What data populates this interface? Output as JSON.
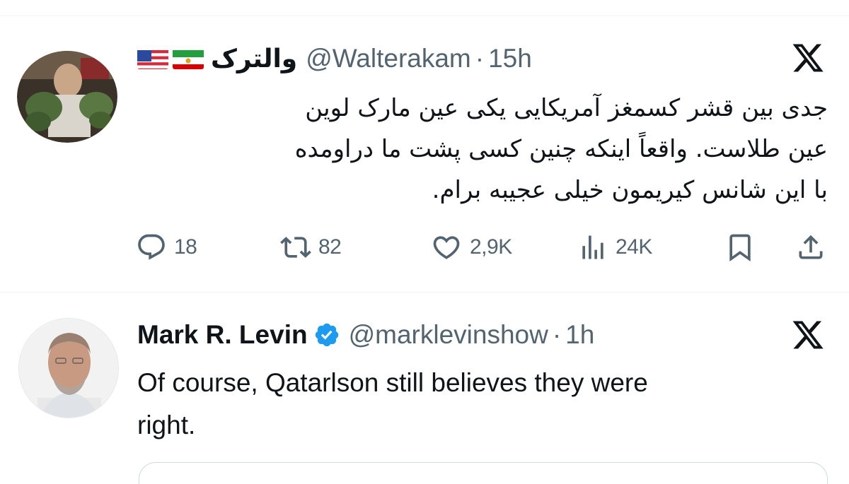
{
  "tweets": [
    {
      "name": "والترک",
      "flags": [
        "us-flag-emoji",
        "iran-lion-sun-flag-emoji"
      ],
      "handle": "@Walterakam",
      "dot": "·",
      "time": "15h",
      "lines": [
        "جدی بین قشر کسمغز آمریکایی یکی عین مارک لوین",
        "عین طلاست. واقعاً اینکه چنین کسی پشت ما دراومده",
        "با این شانس کیریمون خیلی عجیبه برام."
      ],
      "replies": "18",
      "reposts": "82",
      "likes": "2,9K",
      "views": "24K",
      "icons": [
        "reply-icon",
        "repost-icon",
        "like-icon",
        "views-icon",
        "bookmark-icon",
        "share-icon",
        "x-logo-icon"
      ]
    },
    {
      "name": "Mark R. Levin",
      "verified": true,
      "handle": "@marklevinshow",
      "dot": "·",
      "time": "1h",
      "lines": [
        "Of course, Qatarlson still believes they were",
        "right."
      ],
      "icons": [
        "verified-badge-icon",
        "x-logo-icon"
      ]
    }
  ],
  "colors": {
    "text": "#0f1419",
    "secondary": "#536471",
    "divider": "#eff3f4",
    "verified": "#1d9bf0"
  }
}
